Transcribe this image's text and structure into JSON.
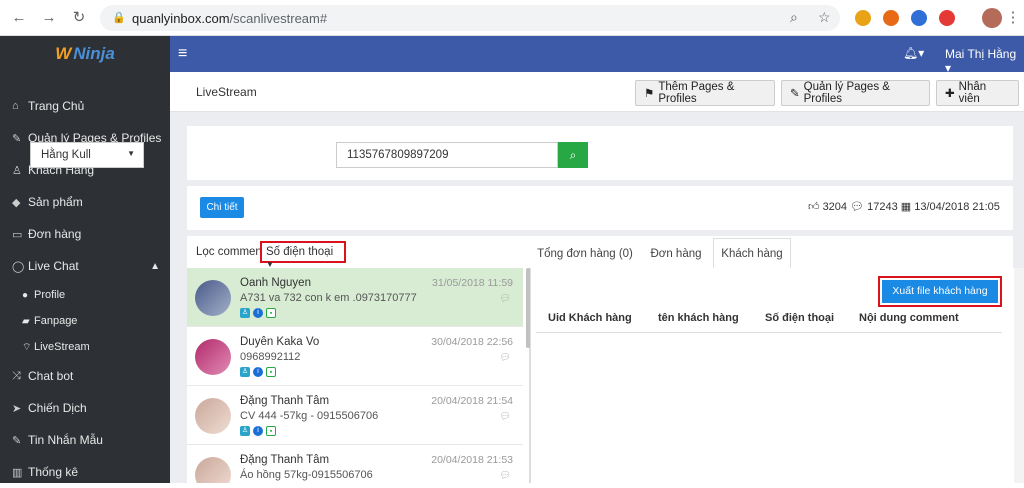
{
  "browser": {
    "url_host": "quanlyinbox.com",
    "url_path": "/scanlivestream#"
  },
  "sidebar": {
    "logo": "Ninja",
    "items": [
      {
        "label": "Trang Chủ",
        "icon": "home-icon"
      },
      {
        "label": "Quản lý Pages & Profiles",
        "icon": "plug-icon"
      },
      {
        "label": "Khách Hàng",
        "icon": "user-icon"
      },
      {
        "label": "Sản phẩm",
        "icon": "cube-icon"
      },
      {
        "label": "Đơn hàng",
        "icon": "card-icon"
      },
      {
        "label": "Live Chat",
        "icon": "chat-icon"
      }
    ],
    "sub_items": [
      {
        "label": "Profile",
        "icon": "user-circle-icon"
      },
      {
        "label": "Fanpage",
        "icon": "book-icon"
      },
      {
        "label": "LiveStream",
        "icon": "rss-icon"
      }
    ],
    "items2": [
      {
        "label": "Chat bot",
        "icon": "shuffle-icon"
      },
      {
        "label": "Chiến Dịch",
        "icon": "send-icon"
      },
      {
        "label": "Tin Nhắn Mẫu",
        "icon": "tag-icon"
      },
      {
        "label": "Thống kê",
        "icon": "bar-chart-icon"
      }
    ]
  },
  "topbar": {
    "user_name": "Mai Thị Hằng"
  },
  "header": {
    "title": "LiveStream",
    "buttons": [
      {
        "label": "Thêm Pages & Profiles"
      },
      {
        "label": "Quản lý Pages & Profiles"
      },
      {
        "label": "Nhân viên"
      }
    ]
  },
  "search": {
    "page_select": "Hằng Kull",
    "post_id": "1135767809897209"
  },
  "detail_button": "Chi tiết",
  "stats": {
    "likes": "3204",
    "comments": "17243",
    "date": "13/04/2018 21:05"
  },
  "filter": {
    "label": "Lọc comment:",
    "value": "Số điện thoại"
  },
  "tabs": [
    {
      "label": "Tổng đơn hàng (0)"
    },
    {
      "label": "Đơn hàng"
    },
    {
      "label": "Khách hàng"
    }
  ],
  "comments": [
    {
      "name": "Oanh Nguyen",
      "text": "A731 va 732 con k em .0973170777",
      "time": "31/05/2018 11:59"
    },
    {
      "name": "Duyên Kaka Vo",
      "text": "0968992112",
      "time": "30/04/2018 22:56"
    },
    {
      "name": "Đặng Thanh Tâm",
      "text": "CV 444 -57kg - 0915506706",
      "time": "20/04/2018 21:54"
    },
    {
      "name": "Đặng Thanh Tâm",
      "text": "Áo hồng 57kg-0915506706",
      "time": "20/04/2018 21:53"
    }
  ],
  "customers": {
    "export_button": "Xuất file khách hàng",
    "columns": [
      "Uid Khách hàng",
      "tên khách hàng",
      "Số điện thoại",
      "Nội dung comment"
    ]
  },
  "colors": {
    "sidebar_bg": "#2d3035",
    "topbar_bg": "#3c5aa8",
    "primary": "#1a8ae5",
    "success": "#28a745",
    "highlight": "#d9121b",
    "selected_row": "#d7ecd3"
  }
}
